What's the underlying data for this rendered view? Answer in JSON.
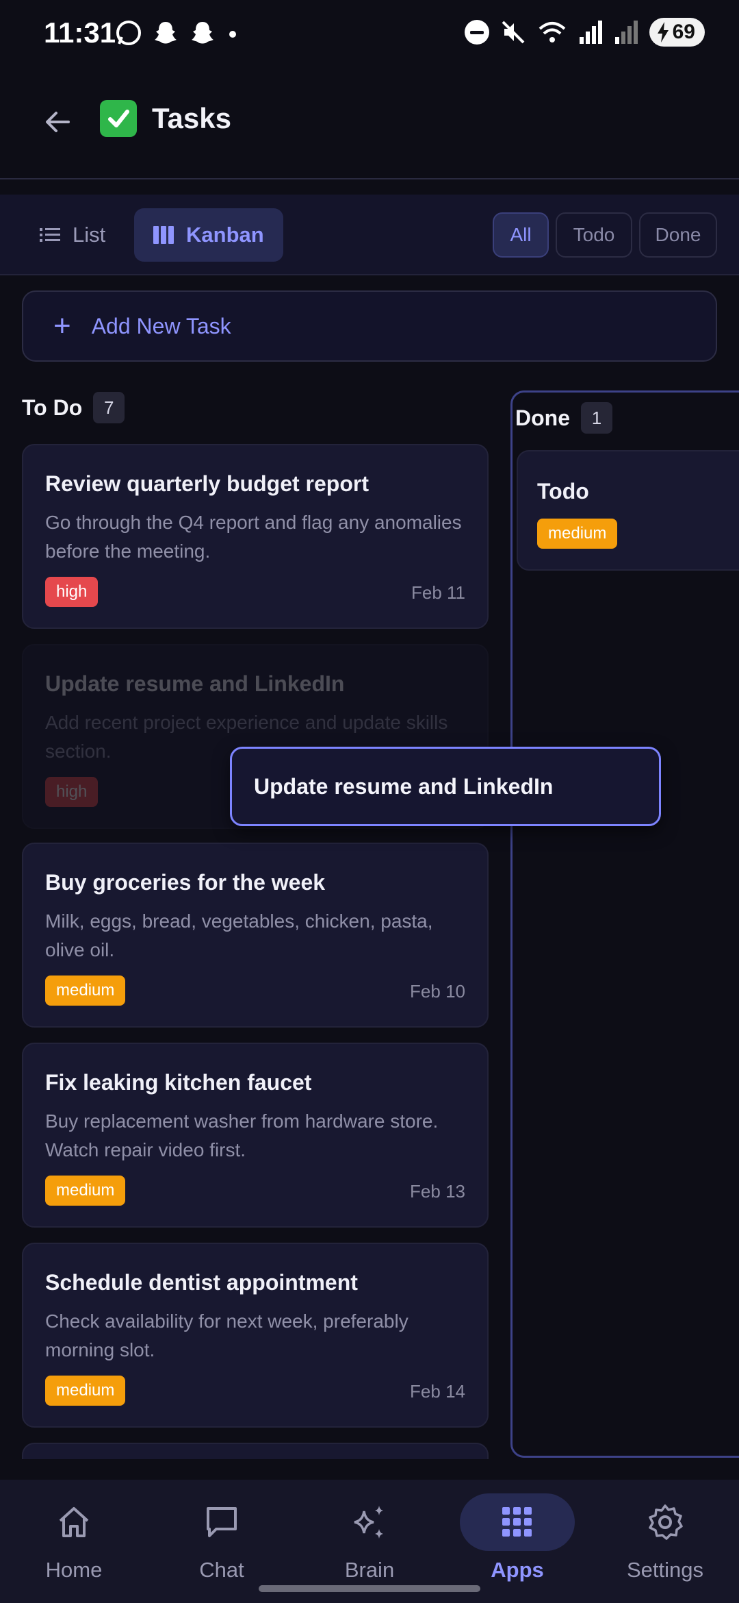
{
  "status_bar": {
    "time": "11:31",
    "battery": "69"
  },
  "app_bar": {
    "title": "Tasks",
    "emoji": "✅"
  },
  "toolbar": {
    "view_list": "List",
    "view_kanban": "Kanban",
    "filters": {
      "all": "All",
      "todo": "Todo",
      "done": "Done"
    },
    "active_view": "Kanban",
    "active_filter": "All"
  },
  "add_task": {
    "label": "Add New Task"
  },
  "todo_column": {
    "title": "To Do",
    "count": "7",
    "cards": [
      {
        "title": "Review quarterly budget report",
        "desc": "Go through the Q4 report and flag any anomalies before the meeting.",
        "priority": "high",
        "date": "Feb 11"
      },
      {
        "title": "Update resume and LinkedIn",
        "desc": "Add recent project experience and update skills section.",
        "priority": "high",
        "date": ""
      },
      {
        "title": "Buy groceries for the week",
        "desc": "Milk, eggs, bread, vegetables, chicken, pasta, olive oil.",
        "priority": "medium",
        "date": "Feb 10"
      },
      {
        "title": "Fix leaking kitchen faucet",
        "desc": "Buy replacement washer from hardware store. Watch repair video first.",
        "priority": "medium",
        "date": "Feb 13"
      },
      {
        "title": "Schedule dentist appointment",
        "desc": "Check availability for next week, preferably morning slot.",
        "priority": "medium",
        "date": "Feb 14"
      }
    ]
  },
  "done_column": {
    "title": "Done",
    "count": "1",
    "cards": [
      {
        "title": "Todo",
        "priority": "medium"
      }
    ]
  },
  "drag_overlay": {
    "title": "Update resume and LinkedIn"
  },
  "bottom_nav": {
    "items": [
      {
        "label": "Home",
        "icon": "home-icon"
      },
      {
        "label": "Chat",
        "icon": "chat-icon"
      },
      {
        "label": "Brain",
        "icon": "sparkle-icon"
      },
      {
        "label": "Apps",
        "icon": "apps-grid-icon"
      },
      {
        "label": "Settings",
        "icon": "gear-icon"
      }
    ],
    "active": "Apps"
  },
  "colors": {
    "accent": "#8f95ff",
    "high": "#e5484d",
    "medium": "#f59e0b",
    "background": "#0d0d16"
  }
}
